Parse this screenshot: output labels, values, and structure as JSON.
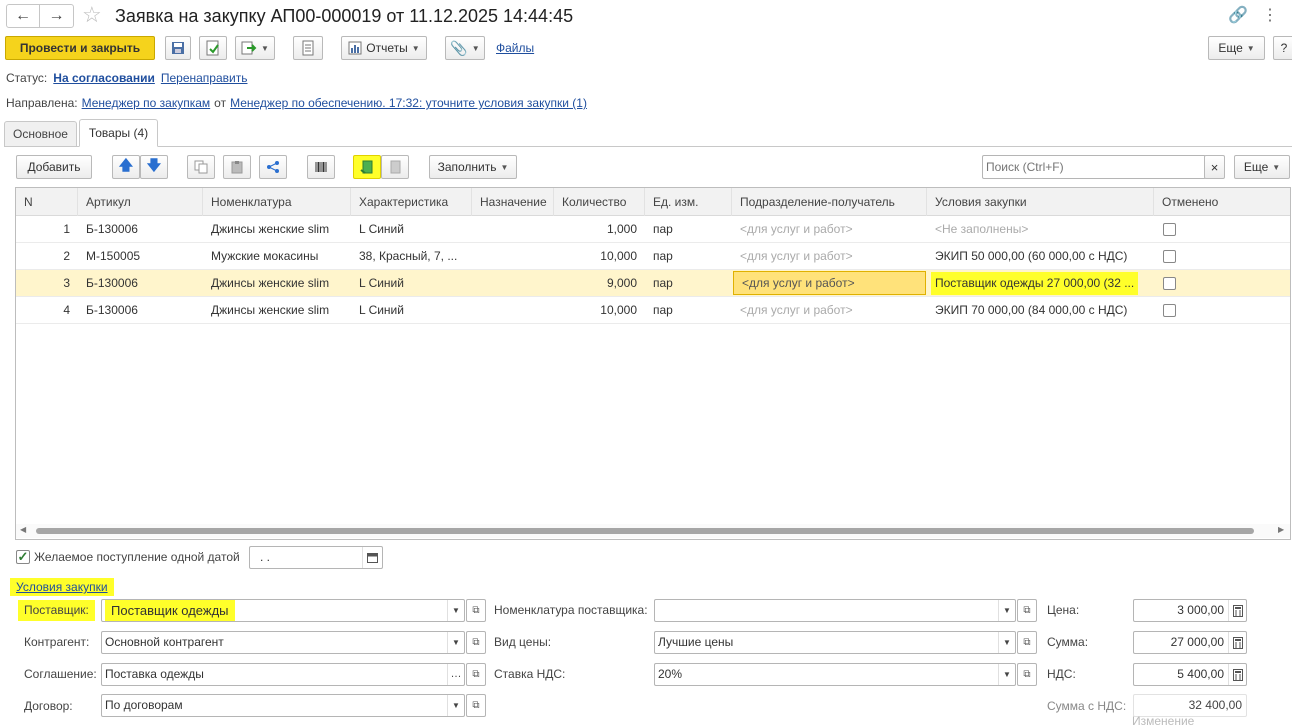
{
  "window": {
    "title": "Заявка на закупку АП00-000019 от 11.12.2025 14:44:45",
    "more_label": "Еще",
    "help_label": "?"
  },
  "toolbar": {
    "post_close_label": "Провести и закрыть",
    "reports_label": "Отчеты",
    "files_label": "Файлы"
  },
  "status": {
    "label": "Статус:",
    "value": "На согласовании",
    "redirect_label": "Перенаправить"
  },
  "directed": {
    "label": "Направлена:",
    "to": "Менеджер по закупкам",
    "from_word": "от",
    "from": "Менеджер по обеспечению. 17:32: уточните условия закупки (1)"
  },
  "tabs": [
    {
      "label": "Основное",
      "active": false
    },
    {
      "label": "Товары (4)",
      "active": true
    }
  ],
  "table_toolbar": {
    "add_label": "Добавить",
    "fill_label": "Заполнить",
    "search_placeholder": "Поиск (Ctrl+F)",
    "clear_label": "×",
    "more_label": "Еще"
  },
  "columns": [
    "N",
    "Артикул",
    "Номенклатура",
    "Характеристика",
    "Назначение",
    "Количество",
    "Ед. изм.",
    "Подразделение-получатель",
    "Условия закупки",
    "Отменено"
  ],
  "rows": [
    {
      "n": "1",
      "article": "Б-130006",
      "nomenclature": "Джинсы женские slim",
      "characteristic": "L Синий",
      "purpose": "",
      "qty": "1,000",
      "unit": "пар",
      "department": "<для услуг и работ>",
      "conditions": "<Не заполнены>",
      "canceled": false
    },
    {
      "n": "2",
      "article": "М-150005",
      "nomenclature": "Мужские мокасины",
      "characteristic": "38, Красный, 7, ...",
      "purpose": "",
      "qty": "10,000",
      "unit": "пар",
      "department": "<для услуг и работ>",
      "conditions": "ЭКИП 50 000,00 (60 000,00 с НДС)",
      "canceled": false
    },
    {
      "n": "3",
      "article": "Б-130006",
      "nomenclature": "Джинсы женские slim",
      "characteristic": "L Синий",
      "purpose": "",
      "qty": "9,000",
      "unit": "пар",
      "department": "<для услуг и работ>",
      "conditions": "Поставщик одежды 27 000,00 (32 ...",
      "canceled": false
    },
    {
      "n": "4",
      "article": "Б-130006",
      "nomenclature": "Джинсы женские slim",
      "characteristic": "L Синий",
      "purpose": "",
      "qty": "10,000",
      "unit": "пар",
      "department": "<для услуг и работ>",
      "conditions": "ЭКИП 70 000,00 (84 000,00 с НДС)",
      "canceled": false
    }
  ],
  "desired_date": {
    "label": "Желаемое поступление одной датой",
    "checked": true,
    "value": " .  ."
  },
  "conditions": {
    "title": "Условия закупки",
    "supplier_label": "Поставщик:",
    "supplier_value": "Поставщик одежды",
    "counterparty_label": "Контрагент:",
    "counterparty_value": "Основной контрагент",
    "agreement_label": "Соглашение:",
    "agreement_value": "Поставка одежды",
    "contract_label": "Договор:",
    "contract_value": "По договорам",
    "supplier_nom_label": "Номенклатура поставщика:",
    "supplier_nom_value": "",
    "price_type_label": "Вид цены:",
    "price_type_value": "Лучшие цены",
    "vat_rate_label": "Ставка НДС:",
    "vat_rate_value": "20%",
    "price_label": "Цена:",
    "price_value": "3 000,00",
    "sum_label": "Сумма:",
    "sum_value": "27 000,00",
    "vat_label": "НДС:",
    "vat_value": "5 400,00",
    "sum_vat_label": "Сумма с НДС:",
    "sum_vat_value": "32 400,00",
    "change_label": "Изменение"
  },
  "colors": {
    "primary_button": "#f5d31c",
    "selected_row": "#fff5cc",
    "link": "#1f4e9e",
    "highlight": "#ffff2a"
  }
}
